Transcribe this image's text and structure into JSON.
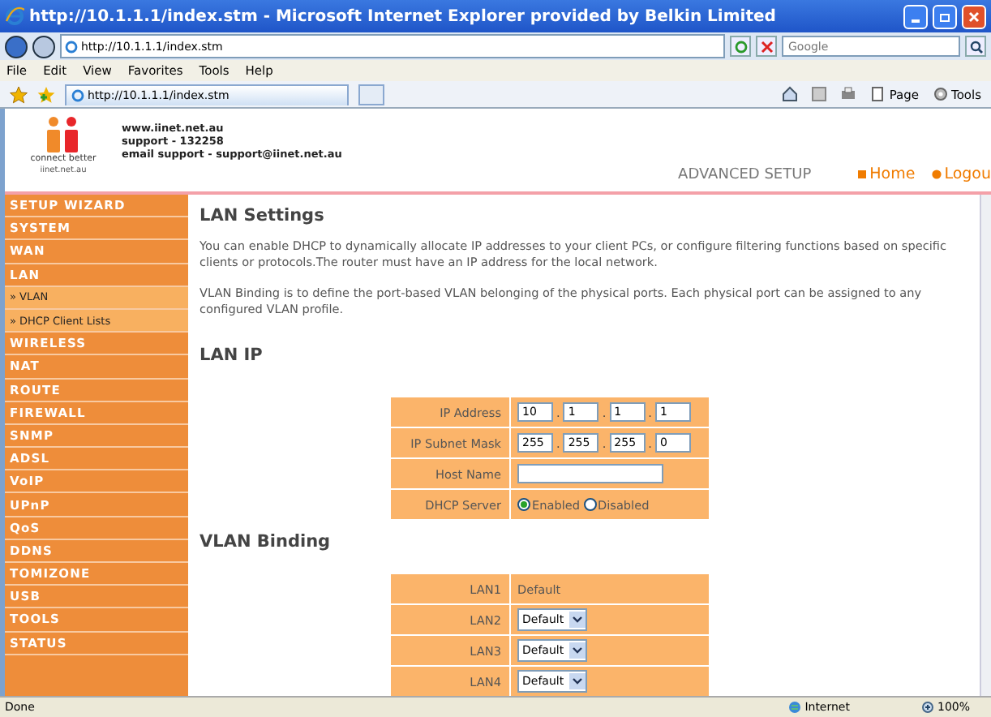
{
  "window": {
    "title": "http://10.1.1.1/index.stm - Microsoft Internet Explorer provided by Belkin Limited"
  },
  "address_bar": {
    "url": "http://10.1.1.1/index.stm",
    "search_placeholder": "Google"
  },
  "menu": [
    "File",
    "Edit",
    "View",
    "Favorites",
    "Tools",
    "Help"
  ],
  "tab": {
    "title": "http://10.1.1.1/index.stm"
  },
  "commands": [
    "Page",
    "Tools"
  ],
  "header": {
    "logo_tagline": "connect better",
    "logo_site": "iinet.net.au",
    "info": [
      "www.iinet.net.au",
      "support - 132258",
      "email support - support@iinet.net.au"
    ],
    "section": "ADVANCED SETUP",
    "links": [
      {
        "label": "Home",
        "kind": "square"
      },
      {
        "label": "Logou",
        "kind": "dot"
      }
    ]
  },
  "sidebar": {
    "items": [
      {
        "label": "SETUP WIZARD",
        "kind": "main"
      },
      {
        "label": "SYSTEM",
        "kind": "main"
      },
      {
        "label": "WAN",
        "kind": "main"
      },
      {
        "label": "LAN",
        "kind": "main"
      },
      {
        "label": "» VLAN",
        "kind": "sub"
      },
      {
        "label": "» DHCP Client Lists",
        "kind": "sub"
      },
      {
        "label": "WIRELESS",
        "kind": "main"
      },
      {
        "label": "NAT",
        "kind": "main"
      },
      {
        "label": "ROUTE",
        "kind": "main"
      },
      {
        "label": "FIREWALL",
        "kind": "main"
      },
      {
        "label": "SNMP",
        "kind": "main"
      },
      {
        "label": "ADSL",
        "kind": "main"
      },
      {
        "label": "VoIP",
        "kind": "main"
      },
      {
        "label": "UPnP",
        "kind": "main"
      },
      {
        "label": "QoS",
        "kind": "main"
      },
      {
        "label": "DDNS",
        "kind": "main"
      },
      {
        "label": "TOMIZONE",
        "kind": "main"
      },
      {
        "label": "USB",
        "kind": "main"
      },
      {
        "label": "TOOLS",
        "kind": "main"
      },
      {
        "label": "STATUS",
        "kind": "main"
      }
    ]
  },
  "content": {
    "title": "LAN Settings",
    "paragraphs": [
      "You can enable DHCP to dynamically allocate IP addresses to your client PCs, or configure filtering functions based on specific clients or protocols.The router must have an IP address for the local network.",
      "VLAN Binding is to define the port-based VLAN belonging of the physical ports. Each physical port can be assigned to any configured VLAN profile."
    ],
    "lan_ip": {
      "heading": "LAN IP",
      "fields": [
        {
          "label": "IP Address",
          "kind": "octets",
          "separator": ".",
          "values": [
            "10",
            "1",
            "1",
            "1"
          ]
        },
        {
          "label": "IP Subnet Mask",
          "kind": "octets",
          "separator": ".",
          "values": [
            "255",
            "255",
            "255",
            "0"
          ]
        },
        {
          "label": "Host Name",
          "kind": "text"
        },
        {
          "label": "DHCP Server",
          "kind": "radio",
          "options": [
            {
              "label": "Enabled",
              "selected": true
            },
            {
              "label": "Disabled",
              "selected": false
            }
          ]
        }
      ]
    },
    "vlan_binding": {
      "heading": "VLAN Binding",
      "rows": [
        {
          "port": "LAN1",
          "kind": "text",
          "value": "Default"
        },
        {
          "port": "LAN2",
          "kind": "select",
          "value": "Default"
        },
        {
          "port": "LAN3",
          "kind": "select",
          "value": "Default"
        },
        {
          "port": "LAN4",
          "kind": "select",
          "value": "Default"
        }
      ]
    }
  },
  "status_bar": {
    "text": "Done",
    "zone": "Internet",
    "zoom": "100%"
  }
}
